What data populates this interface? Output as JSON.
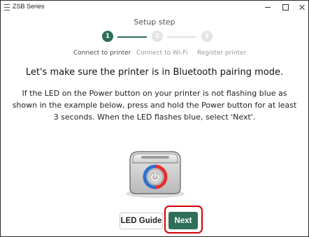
{
  "window": {
    "title": "ZSB Series"
  },
  "stepper": {
    "heading": "Setup step",
    "steps": [
      {
        "number": "1",
        "label": "Connect to printer",
        "state": "active"
      },
      {
        "number": "2",
        "label": "Connect to Wi-Fi",
        "state": "inactive"
      },
      {
        "number": "3",
        "label": "Register printer",
        "state": "inactive"
      }
    ],
    "active_color": "#2f6e58",
    "inactive_color": "#e4e4e4"
  },
  "main": {
    "heading": "Let's make sure the printer is in Bluetooth pairing mode.",
    "instructions": "If the LED on the Power button on your printer is not flashing blue as shown in the example below, press and hold the Power button for at least 3 seconds. When the LED flashes blue, select 'Next'."
  },
  "illustration": {
    "icon": "printer-power-led-icon",
    "led_colors": [
      "#2f6fd0",
      "#e0312f"
    ]
  },
  "footer": {
    "led_guide_label": "LED Guide",
    "next_label": "Next",
    "highlight_color": "#d40000"
  }
}
